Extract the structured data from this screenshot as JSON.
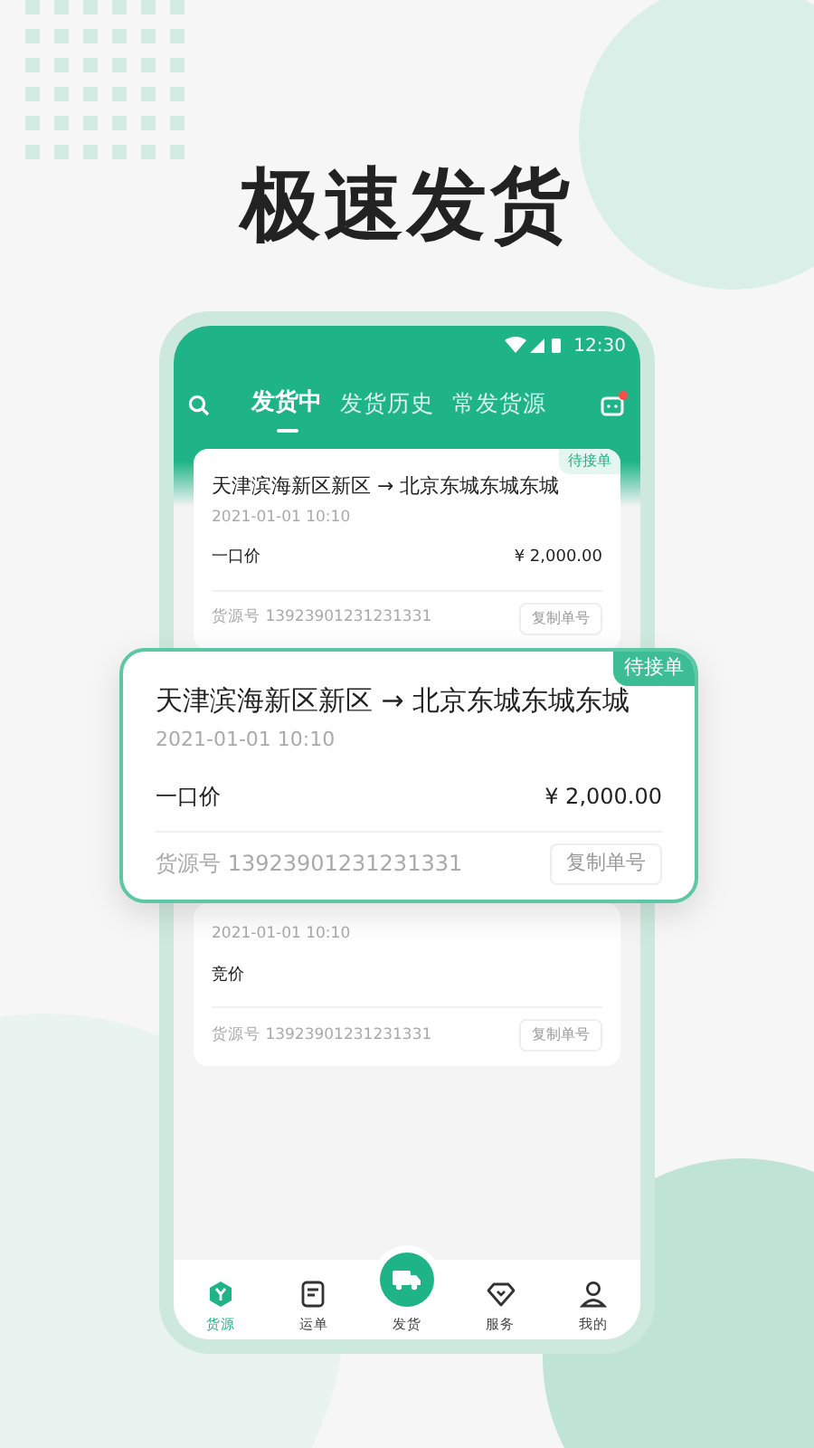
{
  "headline": "极速发货",
  "status_bar": {
    "time": "12:30"
  },
  "tabs": [
    {
      "label": "发货中",
      "selected": true
    },
    {
      "label": "发货历史",
      "selected": false
    },
    {
      "label": "常发货源",
      "selected": false
    }
  ],
  "messages": {
    "unread": true
  },
  "orders": [
    {
      "badge": "待接单",
      "route": "天津滨海新区新区 → 北京东城东城东城",
      "date": "2021-01-01  10:10",
      "price_type": "一口价",
      "price": "¥ 2,000.00",
      "source_label": "货源号",
      "source_no": "13923901231231331",
      "copy_button": "复制单号"
    },
    {
      "date": "2021-01-01  10:10",
      "price_type": "竞价",
      "source_label": "货源号",
      "source_no": "13923901231231331",
      "copy_button": "复制单号"
    }
  ],
  "popup": {
    "badge": "待接单",
    "route": "天津滨海新区新区 → 北京东城东城东城",
    "date": "2021-01-01  10:10",
    "price_type": "一口价",
    "price": "¥ 2,000.00",
    "source_label": "货源号",
    "source_no": "13923901231231331",
    "copy_button": "复制单号"
  },
  "bottom_nav": [
    {
      "label": "货源",
      "kind": "source",
      "selected": true
    },
    {
      "label": "运单",
      "kind": "waybill",
      "selected": false
    },
    {
      "label": "发货",
      "kind": "ship",
      "selected": false
    },
    {
      "label": "服务",
      "kind": "service",
      "selected": false
    },
    {
      "label": "我的",
      "kind": "profile",
      "selected": false
    }
  ]
}
